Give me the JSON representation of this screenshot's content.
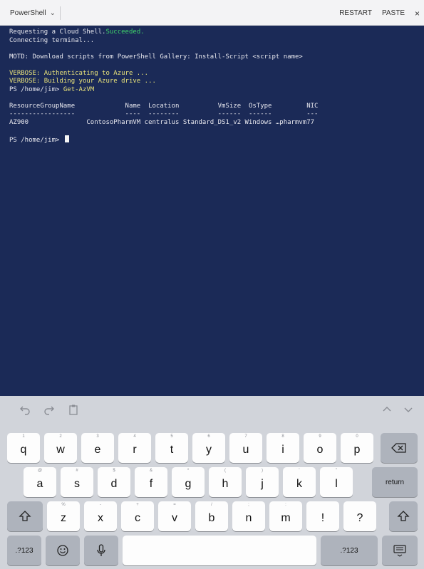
{
  "topbar": {
    "shell_label": "PowerShell",
    "restart_label": "RESTART",
    "paste_label": "PASTE",
    "close_label": "×"
  },
  "terminal": {
    "line1_prefix": "Requesting a Cloud Shell.",
    "line1_status": "Succeeded.",
    "line2": "Connecting terminal...",
    "motd": "MOTD: Download scripts from PowerShell Gallery: Install-Script <script name>",
    "verbose1": "VERBOSE: Authenticating to Azure ...",
    "verbose2": "VERBOSE: Building your Azure drive ...",
    "prompt1": "PS /home/jim> ",
    "command1": "Get-AzVM",
    "table_header": "ResourceGroupName             Name  Location          VmSize  OsType         NIC",
    "table_rule": "-----------------             ----  --------          ------  ------         ---",
    "table_row": "AZ900               ContosoPharmVM centralus Standard_DS1_v2 Windows …pharmvm77",
    "prompt2": "PS /home/jim> "
  },
  "keyboard": {
    "row1": [
      {
        "main": "q",
        "sub": "1"
      },
      {
        "main": "w",
        "sub": "2"
      },
      {
        "main": "e",
        "sub": "3"
      },
      {
        "main": "r",
        "sub": "4"
      },
      {
        "main": "t",
        "sub": "5"
      },
      {
        "main": "y",
        "sub": "6"
      },
      {
        "main": "u",
        "sub": "7"
      },
      {
        "main": "i",
        "sub": "8"
      },
      {
        "main": "o",
        "sub": "9"
      },
      {
        "main": "p",
        "sub": "0"
      }
    ],
    "row2": [
      {
        "main": "a",
        "sub": "@"
      },
      {
        "main": "s",
        "sub": "#"
      },
      {
        "main": "d",
        "sub": "$"
      },
      {
        "main": "f",
        "sub": "&"
      },
      {
        "main": "g",
        "sub": "*"
      },
      {
        "main": "h",
        "sub": "("
      },
      {
        "main": "j",
        "sub": ")"
      },
      {
        "main": "k",
        "sub": "'"
      },
      {
        "main": "l",
        "sub": "\""
      }
    ],
    "row3": [
      {
        "main": "z",
        "sub": "%"
      },
      {
        "main": "x",
        "sub": "-"
      },
      {
        "main": "c",
        "sub": "+"
      },
      {
        "main": "v",
        "sub": "="
      },
      {
        "main": "b",
        "sub": "/"
      },
      {
        "main": "n",
        "sub": ";"
      },
      {
        "main": "m",
        "sub": ":"
      },
      {
        "main": "!",
        "sub": ""
      },
      {
        "main": "?",
        "sub": ""
      }
    ],
    "return_label": "return",
    "numbers_label": ".?123",
    "numbers_label_right": ".?123"
  },
  "icons": {
    "undo": "undo-icon",
    "redo": "redo-icon",
    "paste": "clipboard-icon",
    "up": "chevron-up-icon",
    "down": "chevron-down-icon",
    "backspace": "backspace-icon",
    "shift": "shift-icon",
    "emoji": "emoji-icon",
    "mic": "microphone-icon",
    "dismiss": "keyboard-dismiss-icon"
  }
}
